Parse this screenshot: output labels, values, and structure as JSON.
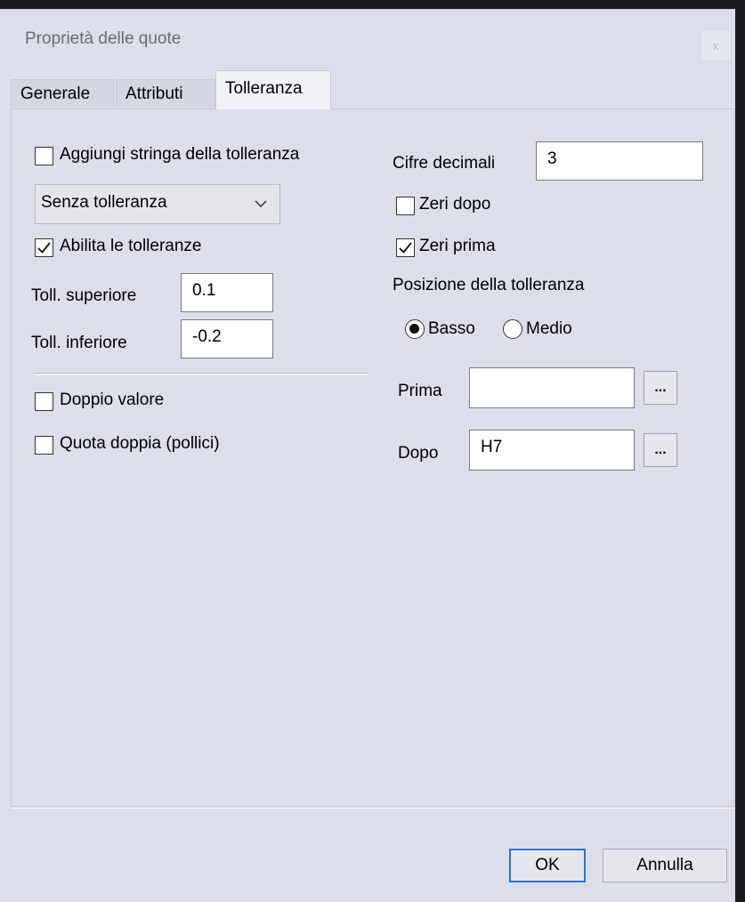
{
  "window": {
    "title": "Proprietà delle quote",
    "close_glyph": "x"
  },
  "tabs": [
    {
      "label": "Generale"
    },
    {
      "label": "Attributi"
    },
    {
      "label": "Tolleranza"
    }
  ],
  "left": {
    "add_tolerance_string": {
      "label": "Aggiungi stringa della tolleranza",
      "checked": false
    },
    "tolerance_type": {
      "value": "Senza tolleranza"
    },
    "enable_tolerances": {
      "label": "Abilita le tolleranze",
      "checked": true
    },
    "upper_tolerance": {
      "label": "Toll. superiore",
      "value": "0.1"
    },
    "lower_tolerance": {
      "label": "Toll. inferiore",
      "value": "-0.2"
    },
    "double_value": {
      "label": "Doppio valore",
      "checked": false
    },
    "dual_dimension": {
      "label": "Quota doppia (pollici)",
      "checked": false
    }
  },
  "right": {
    "decimal_digits": {
      "label": "Cifre decimali",
      "value": "3"
    },
    "trailing_zeros": {
      "label": "Zeri dopo",
      "checked": false
    },
    "leading_zeros": {
      "label": "Zeri prima",
      "checked": true
    },
    "position_heading": "Posizione della tolleranza",
    "position_options": [
      {
        "label": "Basso",
        "selected": true
      },
      {
        "label": "Medio",
        "selected": false
      }
    ],
    "prefix": {
      "label": "Prima",
      "value": "",
      "button_label": "..."
    },
    "suffix": {
      "label": "Dopo",
      "value": "H7",
      "button_label": "..."
    }
  },
  "footer": {
    "ok_label": "OK",
    "cancel_label": "Annulla"
  },
  "colors": {
    "dialog_bg": "#dcdfea",
    "default_button_border": "#2e74d6"
  }
}
